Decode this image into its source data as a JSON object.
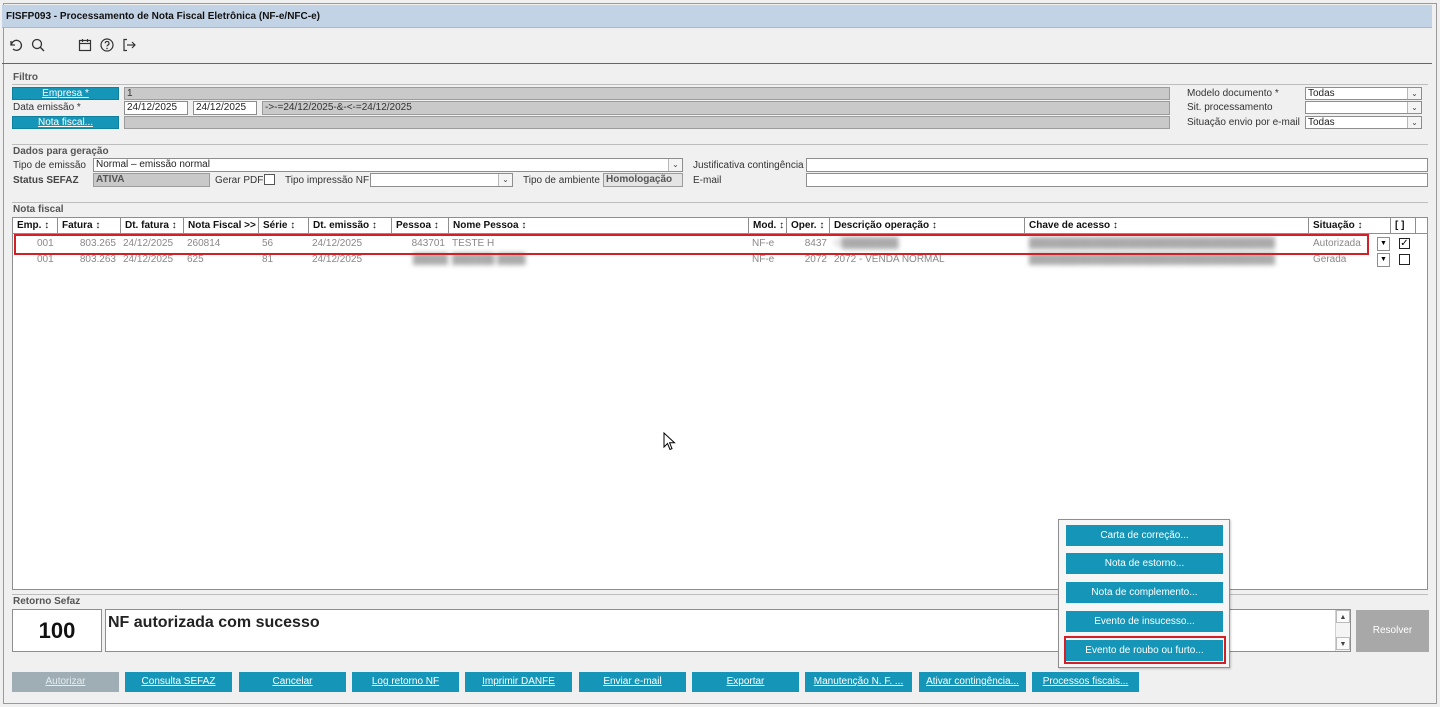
{
  "window": {
    "title": "FISFP093 - Processamento de Nota Fiscal Eletrônica (NF-e/NFC-e)"
  },
  "toolbar": {
    "icons": [
      "undo-icon",
      "search-icon",
      "calendar-icon",
      "help-icon",
      "exit-icon"
    ]
  },
  "filtro": {
    "section": "Filtro",
    "empresa_btn": "Empresa *",
    "empresa_value": "1",
    "data_emissao_label": "Data emissão *",
    "data_inicio": "24/12/2025",
    "data_fim": "24/12/2025",
    "data_expr": "->-=24/12/2025-&-<-=24/12/2025",
    "nota_fiscal_btn": "Nota fiscal...",
    "modelo_label": "Modelo documento *",
    "modelo_value": "Todas",
    "sit_proc_label": "Sit. processamento",
    "sit_proc_value": "",
    "sit_envio_label": "Situação envio por e-mail",
    "sit_envio_value": "Todas"
  },
  "dados": {
    "section": "Dados para geração",
    "tipo_emissao_label": "Tipo de emissão",
    "tipo_emissao_value": "Normal – emissão normal",
    "justificativa_label": "Justificativa contingência",
    "status_label": "Status SEFAZ",
    "status_value": "ATIVA",
    "gerar_pdf_label": "Gerar PDF",
    "tipo_impressao_label": "Tipo impressão NF",
    "tipo_ambiente_label": "Tipo de ambiente",
    "tipo_ambiente_value": "Homologação",
    "email_label": "E-mail"
  },
  "nota": {
    "section": "Nota fiscal",
    "headers": [
      "Emp. ↕",
      "Fatura ↕",
      "Dt. fatura ↕",
      "Nota Fiscal >>",
      "Série ↕",
      "Dt. emissão ↕",
      "Pessoa ↕",
      "Nome Pessoa ↕",
      "Mod. ↕",
      "Oper. ↕",
      "Descrição operação ↕",
      "Chave de acesso ↕",
      "Situação ↕",
      "[ ]"
    ],
    "rows": [
      {
        "emp": "001",
        "fatura": "803.265",
        "dt_fatura": "24/12/2025",
        "nota": "260814",
        "serie": "56",
        "dt_emissao": "24/12/2025",
        "pessoa": "843701",
        "nome": "TESTE H",
        "mod": "NF-e",
        "oper": "8437",
        "descricao": "O████████",
        "chave": "████████████████████████████████████████████",
        "situacao": "Autorizada",
        "checked": "✓"
      },
      {
        "emp": "001",
        "fatura": "803.263",
        "dt_fatura": "24/12/2025",
        "nota": "625",
        "serie": "81",
        "dt_emissao": "24/12/2025",
        "pessoa": "█████",
        "nome": "██████ ████",
        "mod": "NF-e",
        "oper": "2072",
        "descricao": "2072 - VENDA NORMAL",
        "chave": "████████████████████████████████████████████",
        "situacao": "Gerada",
        "checked": ""
      }
    ]
  },
  "retorno": {
    "section": "Retorno Sefaz",
    "code": "100",
    "message": "NF autorizada com sucesso",
    "resolver": "Resolver"
  },
  "popup": {
    "items": [
      "Carta de correção...",
      "Nota de estorno...",
      "Nota de complemento...",
      "Evento de insucesso...",
      "Evento de roubo ou furto..."
    ]
  },
  "footer": {
    "buttons": [
      "Autorizar",
      "Consulta SEFAZ",
      "Cancelar",
      "Log retorno NF",
      "Imprimir DANFE",
      "Enviar e-mail",
      "Exportar",
      "Manutenção N. F. ...",
      "Ativar contingência...",
      "Processos fiscais..."
    ]
  },
  "colors": {
    "accent": "#1596b9",
    "highlight": "#d32027",
    "titlebar": "#c3d3e6"
  }
}
